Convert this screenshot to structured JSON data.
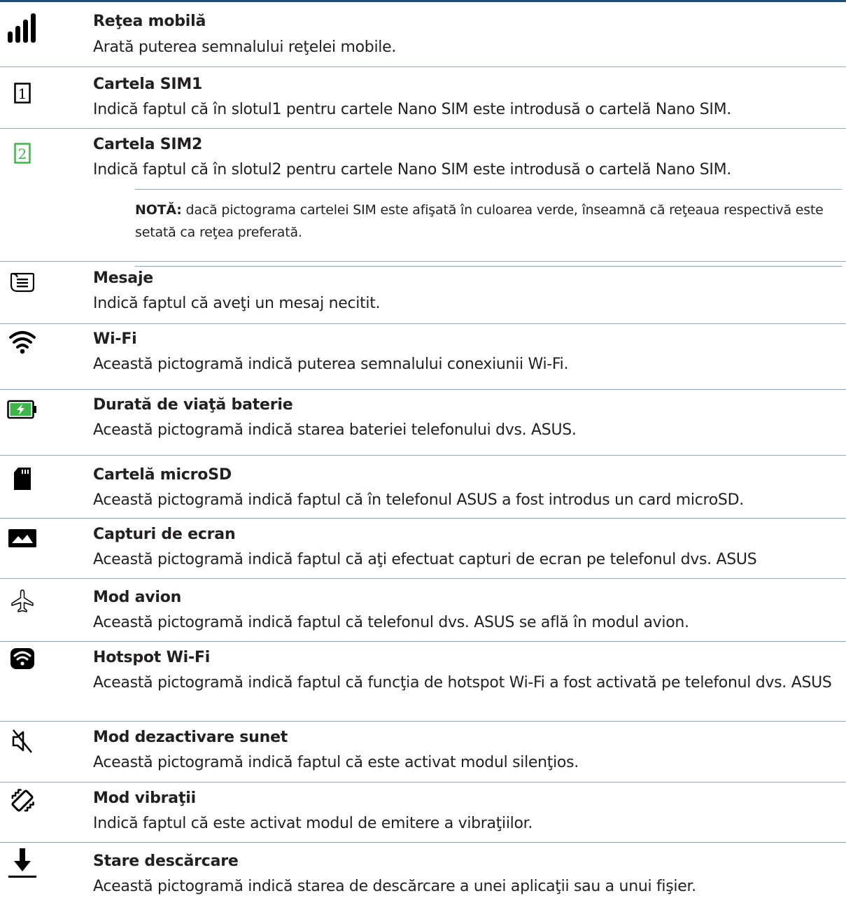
{
  "rows": [
    {
      "title": "Reţea mobilă",
      "desc": "Arată puterea semnalului reţelei mobile."
    },
    {
      "title": "Cartela SIM1",
      "desc": "Indică faptul că în slotul1 pentru cartele Nano SIM este introdusă o cartelă Nano SIM."
    },
    {
      "title": "Cartela SIM2",
      "desc": "Indică faptul că în slotul2 pentru cartele Nano SIM este introdusă o cartelă Nano SIM."
    },
    {
      "title": "Mesaje",
      "desc": "Indică faptul că aveţi un mesaj necitit."
    },
    {
      "title": "Wi-Fi",
      "desc": "Această pictogramă indică puterea semnalului conexiunii Wi-Fi."
    },
    {
      "title": "Durată de viaţă baterie",
      "desc": "Această pictogramă indică starea bateriei telefonului  dvs. ASUS."
    },
    {
      "title": "Cartelă microSD",
      "desc": "Această pictogramă indică faptul că în telefonul ASUS a fost introdus un card microSD."
    },
    {
      "title": "Capturi de ecran",
      "desc": "Această pictogramă indică faptul că aţi efectuat capturi de ecran pe telefonul dvs. ASUS"
    },
    {
      "title": "Mod avion",
      "desc": "Această pictogramă indică faptul că telefonul dvs. ASUS se află în modul avion."
    },
    {
      "title": "Hotspot Wi-Fi",
      "desc": "Această pictogramă indică faptul că funcţia de hotspot Wi-Fi a fost activată pe telefonul dvs. ASUS"
    },
    {
      "title": "Mod dezactivare sunet",
      "desc": "Această pictogramă indică faptul că este activat modul silenţios."
    },
    {
      "title": "Mod vibraţii",
      "desc": "Indică faptul că este activat modul de emitere a vibraţiilor."
    },
    {
      "title": "Stare descărcare",
      "desc": "Această pictogramă indică starea de descărcare a unei aplicaţii sau a unui fişier."
    }
  ],
  "note": {
    "label": "NOTĂ:",
    "text": " dacă pictograma cartelei SIM este afişată în culoarea verde, înseamnă că reţeaua respectivă este setată ca reţea preferată."
  },
  "icons": {
    "sim1_number": "1",
    "sim2_number": "2"
  },
  "colors": {
    "rule": "#1f4e79",
    "separator": "#8fa6c0",
    "sim_preferred": "#3db54a",
    "battery_charge": "#3db54a"
  }
}
